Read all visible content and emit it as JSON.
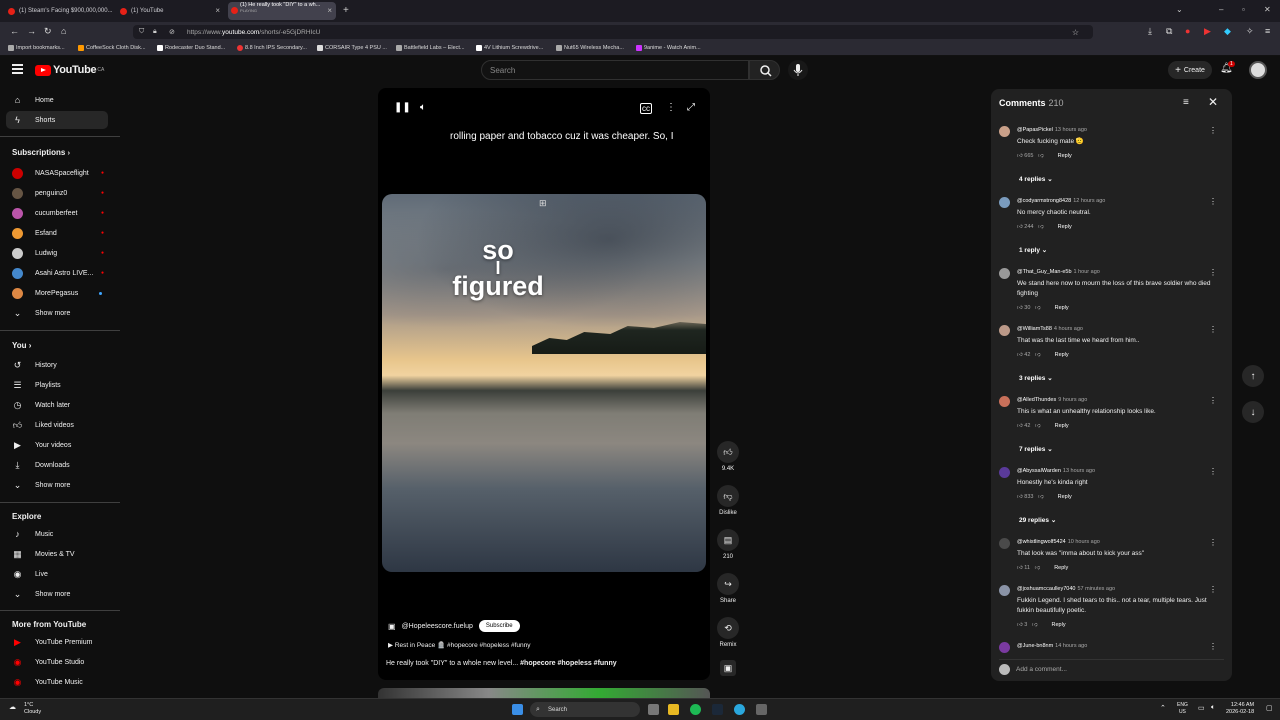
{
  "browser": {
    "tabs": [
      {
        "label": "(1) Steam's Facing $900,000,000..."
      },
      {
        "label": "(1) YouTube"
      },
      {
        "label": "(1) He really took \"DIY\" to a wh..."
      }
    ],
    "tab_sub": "PLAYING",
    "url_prefix": "https://www.",
    "url_host": "youtube.com",
    "url_path": "/shorts/-e5GjDRHIcU",
    "bookmarks": [
      "Import bookmarks...",
      "CoffeeSock Cloth Disk...",
      "Rodecaster Duo Stand...",
      "8.8 Inch IPS Secondary...",
      "CORSAIR Type 4 PSU ...",
      "Battlefield Labs – Elect...",
      "4V Lithium Screwdrive...",
      "Nut65 Wireless Mecha...",
      "9anime - Watch Anim..."
    ]
  },
  "header": {
    "logo_text": "YouTube",
    "logo_region": "CA",
    "search_placeholder": "Search",
    "create_label": "Create",
    "notif_count": "1"
  },
  "sidebar": {
    "home": "Home",
    "shorts": "Shorts",
    "subscriptions_title": "Subscriptions",
    "subscriptions": [
      "NASASpaceflight",
      "penguinz0",
      "cucumberfeet",
      "Esfand",
      "Ludwig",
      "Asahi Astro LIVE...",
      "MorePegasus"
    ],
    "show_more": "Show more",
    "you_title": "You",
    "you_items": [
      "History",
      "Playlists",
      "Watch later",
      "Liked videos",
      "Your videos",
      "Downloads"
    ],
    "explore_title": "Explore",
    "explore_items": [
      "Music",
      "Movies & TV",
      "Live"
    ],
    "more_title": "More from YouTube",
    "more_items": [
      "YouTube Premium",
      "YouTube Studio",
      "YouTube Music"
    ]
  },
  "video": {
    "caption": "rolling paper and tobacco cuz it was cheaper. So, I",
    "overlay_line1": "so",
    "overlay_line2": "I",
    "overlay_line3": "figured",
    "channel": "@Hopeleescore.fuelup",
    "subscribe": "Subscribe",
    "sound": "Rest in Peace 🪦 #hopecore #hopeless #funny",
    "title_plain": "He really took \"DIY\" to a whole new level... ",
    "title_tags": "#hopecore #hopeless #funny"
  },
  "actions": {
    "likes": "9.4K",
    "dislike": "Dislike",
    "comments": "210",
    "share": "Share",
    "remix": "Remix"
  },
  "comments": {
    "title": "Comments",
    "count": "210",
    "reply_label": "Reply",
    "add_placeholder": "Add a comment...",
    "items": [
      {
        "user": "@PapasPickel",
        "time": "13 hours ago",
        "text": "Check fucking mate 🫡",
        "likes": "665",
        "replies": "4 replies"
      },
      {
        "user": "@codyarmstrong8428",
        "time": "12 hours ago",
        "text": "No mercy chaotic neutral.",
        "likes": "244",
        "replies": "1 reply"
      },
      {
        "user": "@That_Guy_Man-e5b",
        "time": "1 hour ago",
        "text": "We stand here now to mourn the loss of this brave soldier who died fighting",
        "likes": "30",
        "replies": ""
      },
      {
        "user": "@WilliamTs88",
        "time": "4 hours ago",
        "text": "That was the last time we heard from him..",
        "likes": "42",
        "replies": "3 replies"
      },
      {
        "user": "@AlledThundes",
        "time": "9 hours ago",
        "text": "This is what an unhealthy relationship looks like.",
        "likes": "42",
        "replies": "7 replies"
      },
      {
        "user": "@AbyssalWarden",
        "time": "13 hours ago",
        "text": "Honestly he's kinda right",
        "likes": "833",
        "replies": "29 replies"
      },
      {
        "user": "@whistlingwolf5424",
        "time": "10 hours ago",
        "text": "That look was \"imma about to kick your ass\"",
        "likes": "11",
        "replies": ""
      },
      {
        "user": "@joshuamccaulley7040",
        "time": "57 minutes ago",
        "text": "Fukkin Legend. I shed tears to this.. not a tear, multiple tears. Just fukkin beautifully poetic.",
        "likes": "3",
        "replies": ""
      },
      {
        "user": "@June-bn8nm",
        "time": "14 hours ago",
        "text": "",
        "likes": "",
        "replies": ""
      }
    ]
  },
  "taskbar": {
    "weather_temp": "1°C",
    "weather_desc": "Cloudy",
    "search": "Search",
    "lang1": "ENG",
    "lang2": "US",
    "time": "12:46 AM",
    "date": "2026-02-18"
  }
}
